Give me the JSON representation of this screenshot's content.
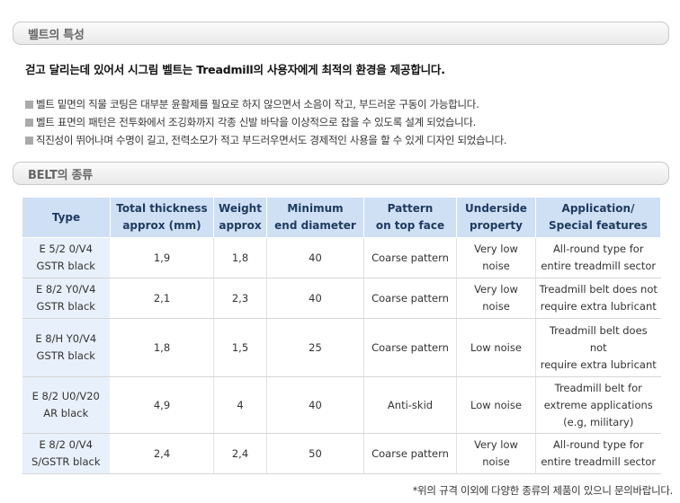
{
  "sections": {
    "features_title": "벨트의 특성",
    "types_title": "BELT의 종류"
  },
  "intro": "걷고 달리는데 있어서 시그림 벨트는 Treadmill의 사용자에게 최적의 환경을 제공합니다.",
  "bullets": [
    "벨트 밑면의 직물 코팅은 대부분 윤활제를 필요로 하지 않으면서 소음이 작고, 부드러운 구동이 가능합니다.",
    "벨트 표면의 패턴은 전투화에서 조깅화까지 각종 신발 바닥을 이상적으로 잡을 수 있도록 설계 되었습니다.",
    "직진성이 뛰어나며 수명이 길고, 전력소모가 적고 부드러우면서도 경제적인 사용을 할 수 있게 디자인 되었습니다."
  ],
  "table": {
    "headers": [
      {
        "l1": "Type",
        "l2": ""
      },
      {
        "l1": "Total thickness",
        "l2": "approx (mm)"
      },
      {
        "l1": "Weight",
        "l2": "approx"
      },
      {
        "l1": "Minimum",
        "l2": "end diameter"
      },
      {
        "l1": "Pattern",
        "l2": "on top face"
      },
      {
        "l1": "Underside",
        "l2": "property"
      },
      {
        "l1": "Application/",
        "l2": "Special features"
      }
    ],
    "rows": [
      {
        "type": [
          "E 5/2 0/V4",
          "GSTR black"
        ],
        "thickness": "1,9",
        "weight": "1,8",
        "diameter": "40",
        "pattern": "Coarse pattern",
        "underside": [
          "Very low",
          "noise"
        ],
        "application": [
          "All-round type for",
          "entire treadmill sector"
        ]
      },
      {
        "type": [
          "E 8/2 Y0/V4",
          "GSTR black"
        ],
        "thickness": "2,1",
        "weight": "2,3",
        "diameter": "40",
        "pattern": "Coarse pattern",
        "underside": [
          "Very low",
          "noise"
        ],
        "application": [
          "Treadmill belt does not",
          "require extra lubricant"
        ]
      },
      {
        "type": [
          "E 8/H Y0/V4",
          "GSTR black"
        ],
        "thickness": "1,8",
        "weight": "1,5",
        "diameter": "25",
        "pattern": "Coarse pattern",
        "underside": [
          "Low noise"
        ],
        "application": [
          "Treadmill belt does",
          "not",
          "require extra lubricant"
        ]
      },
      {
        "type": [
          "E 8/2 U0/V20",
          "AR black"
        ],
        "thickness": "4,9",
        "weight": "4",
        "diameter": "40",
        "pattern": "Anti-skid",
        "underside": [
          "Low noise"
        ],
        "application": [
          "Treadmill belt for",
          "extreme applications",
          "(e.g, military)"
        ]
      },
      {
        "type": [
          "E 8/2 0/V4",
          "S/GSTR black"
        ],
        "thickness": "2,4",
        "weight": "2,4",
        "diameter": "50",
        "pattern": "Coarse pattern",
        "underside": [
          "Very low",
          "noise"
        ],
        "application": [
          "All-round type for",
          "entire treadmill sector"
        ]
      }
    ]
  },
  "footer": "*위의 규격 이외에 다양한 종류의 제품이 있으니 문의바랍니다."
}
